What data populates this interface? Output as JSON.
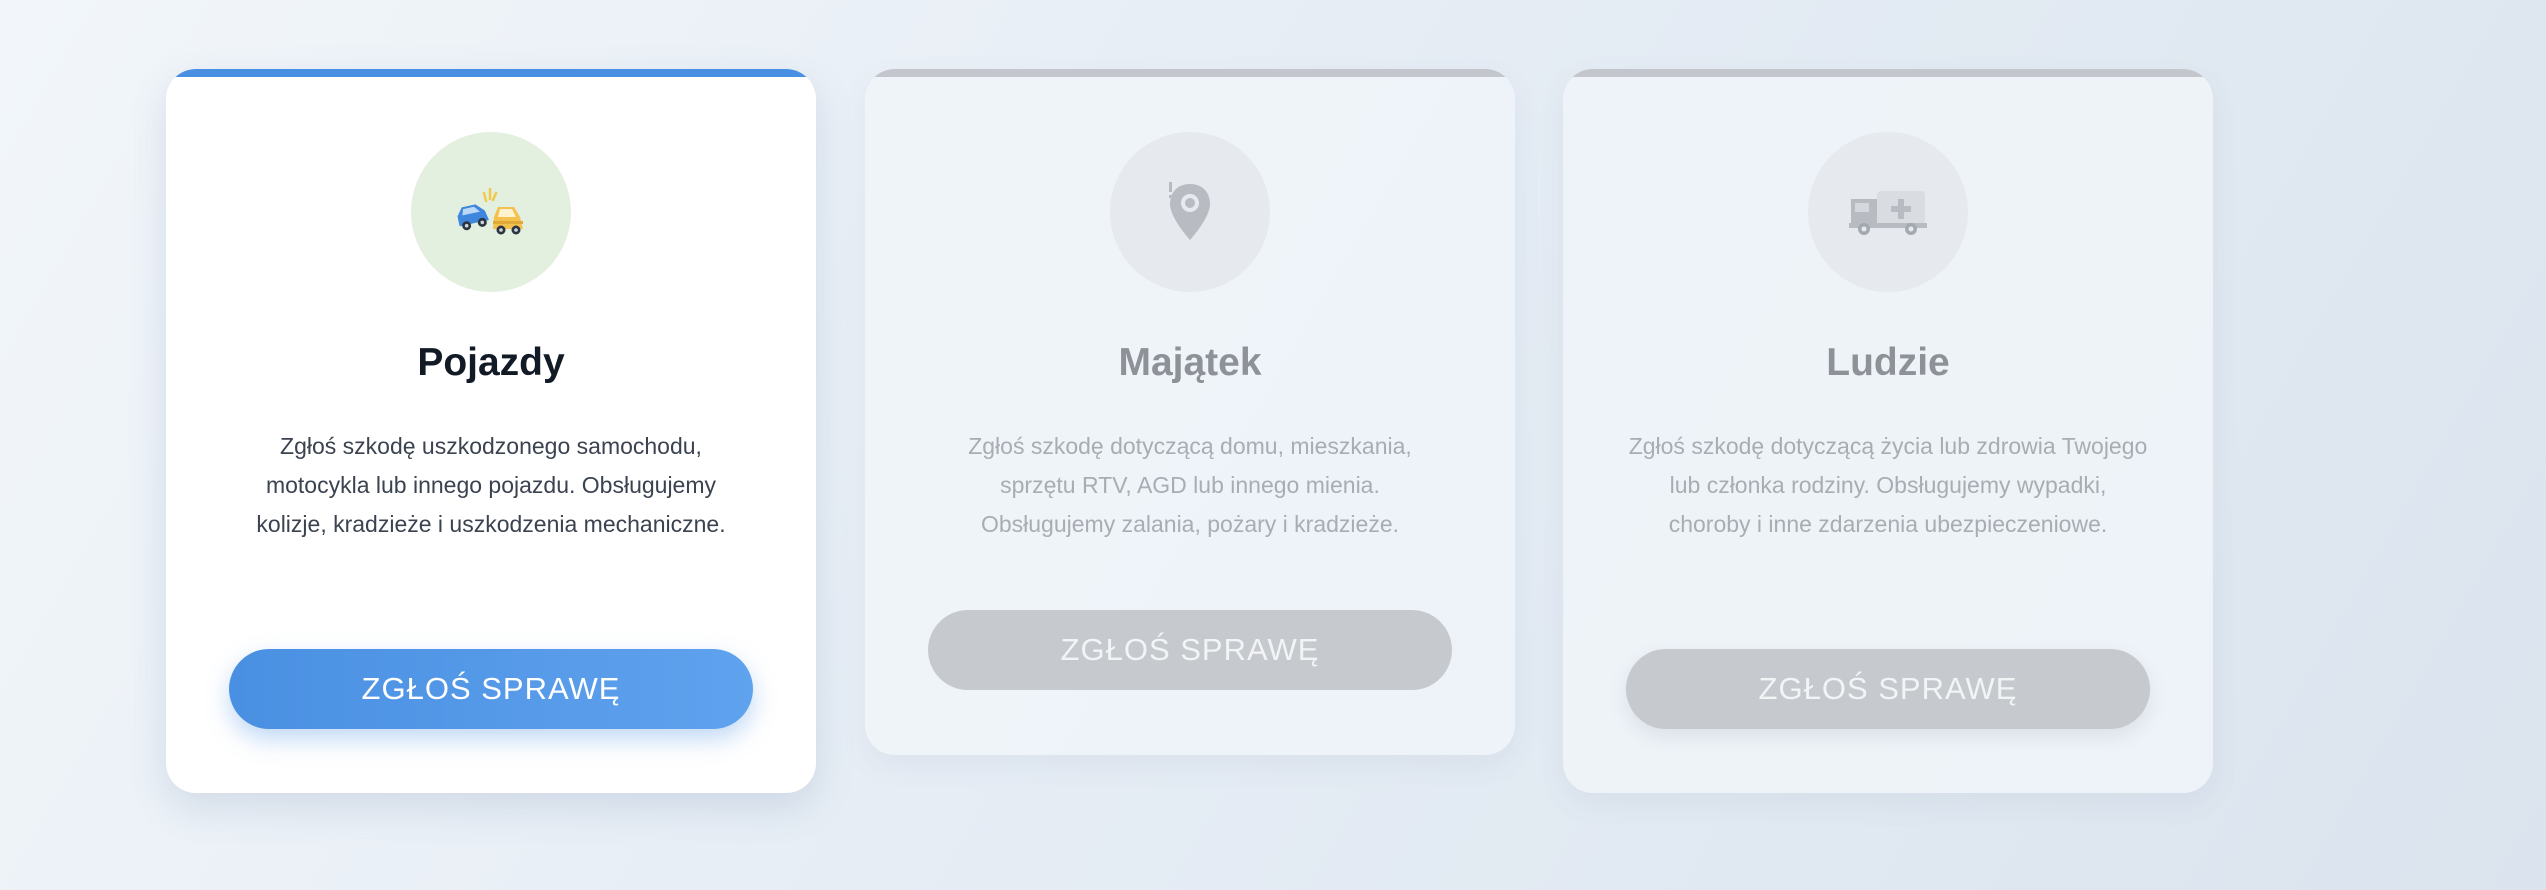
{
  "cards": [
    {
      "title": "Pojazdy",
      "description": "Zgłoś szkodę uszkodzonego samochodu, motocykla lub innego pojazdu. Obsługujemy kolizje, kradzieże i uszkodzenia mechaniczne.",
      "button_label": "ZGŁOŚ SPRAWĘ",
      "icon": "car-collision-icon",
      "state": "active",
      "accent": "#4a90e2"
    },
    {
      "title": "Majątek",
      "description": "Zgłoś szkodę dotyczącą domu, mieszkania, sprzętu RTV, AGD lub innego mienia. Obsługujemy zalania, pożary i kradzieże.",
      "button_label": "ZGŁOŚ SPRAWĘ",
      "icon": "location-pin-icon",
      "state": "inactive",
      "accent": "#c6c9ce"
    },
    {
      "title": "Ludzie",
      "description": "Zgłoś szkodę dotyczącą życia lub zdrowia Twojego lub członka rodziny. Obsługujemy wypadki, choroby i inne zdarzenia ubezpieczeniowe.",
      "button_label": "ZGŁOŚ SPRAWĘ",
      "icon": "ambulance-icon",
      "state": "inactive",
      "accent": "#c6c9ce"
    }
  ]
}
